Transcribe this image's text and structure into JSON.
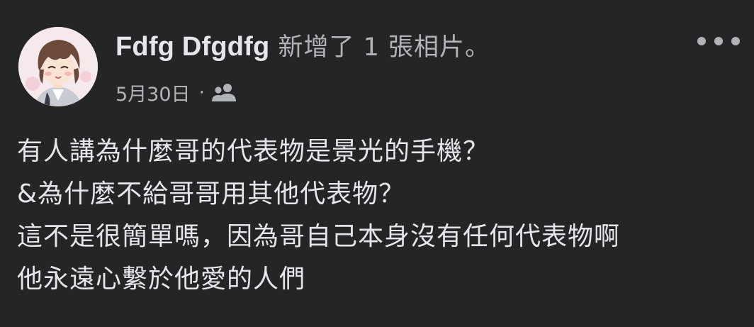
{
  "post": {
    "author": "Fdfg Dfgdfg",
    "action": "新增了 1 張相片。",
    "date": "5月30日",
    "separator": "·",
    "audience_icon": "friends-icon",
    "more_icon": "more-horizontal-icon",
    "body_lines": [
      "有人講為什麼哥的代表物是景光的手機？",
      "&為什麼不給哥哥用其他代表物？",
      "這不是很簡單嗎，因為哥自己本身沒有任何代表物啊",
      "他永遠心繫於他愛的人們"
    ]
  },
  "colors": {
    "background": "#242526",
    "primary_text": "#e4e6eb",
    "secondary_text": "#b0b3b8"
  }
}
